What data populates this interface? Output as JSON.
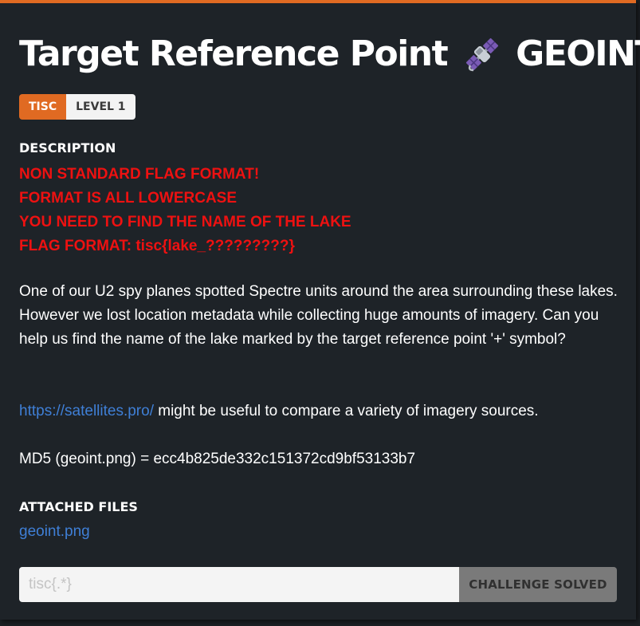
{
  "challenge": {
    "title": "Target Reference Point",
    "category": "GEOINT",
    "title_icon": "satellite-icon",
    "tags": {
      "event": "TISC",
      "level": "LEVEL 1"
    }
  },
  "description": {
    "label": "DESCRIPTION",
    "warnings": [
      "NON STANDARD FLAG FORMAT!",
      "FORMAT IS ALL LOWERCASE",
      "YOU NEED TO FIND THE NAME OF THE LAKE",
      "FLAG FORMAT: tisc{lake_?????????}"
    ],
    "paragraph": "One of our U2 spy planes spotted Spectre units around the area surrounding these lakes. However we lost location metadata while collecting huge amounts of imagery. Can you help us find the name of the lake marked by the target reference point '+' symbol?",
    "link_text": "https://satellites.pro/",
    "link_suffix": " might be useful to compare a variety of imagery sources.",
    "md5": "MD5 (geoint.png) = ecc4b825de332c151372cd9bf53133b7"
  },
  "attachments": {
    "label": "ATTACHED FILES",
    "files": [
      "geoint.png"
    ]
  },
  "flag_form": {
    "placeholder": "tisc{.*}",
    "button_label": "CHALLENGE SOLVED"
  },
  "colors": {
    "accent": "#e06a22",
    "warning_red": "#ee1111",
    "link_blue": "#3f7fd6",
    "card_bg": "#1e2328"
  }
}
